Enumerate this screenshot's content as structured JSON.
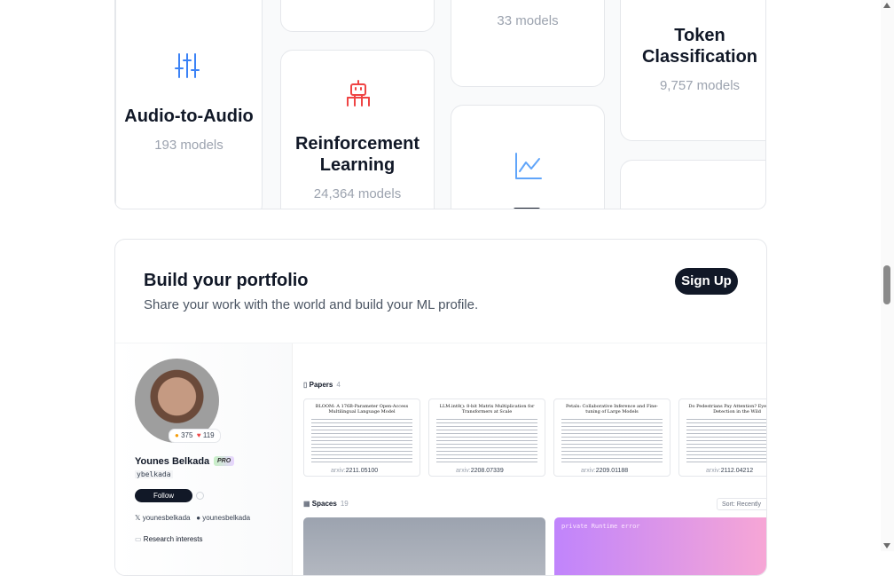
{
  "tasks": {
    "audio_to_audio": {
      "name": "Audio-to-Audio",
      "count": "193 models",
      "icon": "sliders-icon"
    },
    "reinforcement_learning": {
      "name_line1": "Reinforcement",
      "name_line2": "Learning",
      "count": "24,364 models",
      "icon": "robot-icon"
    },
    "partial_middle": {
      "count": "33 models"
    },
    "token_classification": {
      "name_line1": "Token",
      "name_line2": "Classification",
      "count": "9,757 models"
    },
    "partial_chart": {
      "icon": "line-chart-icon"
    }
  },
  "portfolio": {
    "title": "Build your portfolio",
    "subtitle": "Share your work with the world and build your ML profile.",
    "signup_label": "Sign Up",
    "profile": {
      "name": "Younes Belkada",
      "badge": "PRO",
      "handle": "ybelkada",
      "likes": "375",
      "hearts": "119",
      "follow_label": "Follow",
      "twitter": "younesbelkada",
      "github": "younesbelkada",
      "research_label": "Research interests"
    },
    "papers": {
      "label": "Papers",
      "count": "4",
      "items": [
        {
          "title": "BLOOM: A 176B-Parameter Open-Access Multilingual Language Model",
          "arxiv_prefix": "arxiv:",
          "arxiv_id": "2211.05100"
        },
        {
          "title": "LLM.int8(): 8-bit Matrix Multiplication for Transformers at Scale",
          "arxiv_prefix": "arxiv:",
          "arxiv_id": "2208.07339"
        },
        {
          "title": "Petals: Collaborative Inference and Fine-tuning of Large Models",
          "arxiv_prefix": "arxiv:",
          "arxiv_id": "2209.01188"
        },
        {
          "title": "Do Pedestrians Pay Attention? Eye Contact Detection in the Wild",
          "arxiv_prefix": "arxiv:",
          "arxiv_id": "2112.04212"
        }
      ]
    },
    "spaces": {
      "label": "Spaces",
      "count": "19",
      "sort_label": "Sort: Recently",
      "space2_text": "private  Runtime error"
    }
  },
  "colors": {
    "sliders_icon": "#3b82f6",
    "robot_icon": "#ef4444",
    "chart_icon": "#60a5fa",
    "signup_bg": "#111827"
  }
}
